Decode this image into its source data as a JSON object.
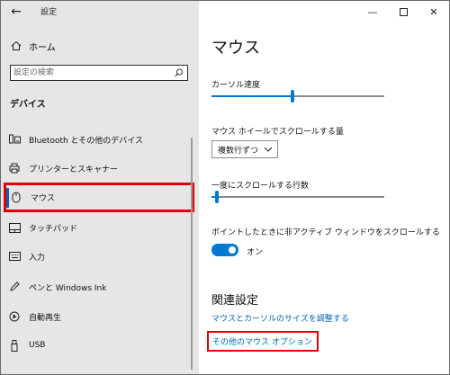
{
  "window": {
    "title": "設定"
  },
  "sidebar": {
    "home_label": "ホーム",
    "search_placeholder": "設定の検索",
    "section_title": "デバイス",
    "items": [
      {
        "label": "Bluetooth とその他のデバイス",
        "icon": "bluetooth-devices-icon"
      },
      {
        "label": "プリンターとスキャナー",
        "icon": "printer-icon"
      },
      {
        "label": "マウス",
        "icon": "mouse-icon",
        "selected": true
      },
      {
        "label": "タッチパッド",
        "icon": "touchpad-icon"
      },
      {
        "label": "入力",
        "icon": "keyboard-icon"
      },
      {
        "label": "ペンと Windows Ink",
        "icon": "pen-icon"
      },
      {
        "label": "自動再生",
        "icon": "autoplay-icon"
      },
      {
        "label": "USB",
        "icon": "usb-icon"
      }
    ]
  },
  "main": {
    "title": "マウス",
    "cursor_speed": {
      "label": "カーソル速度",
      "value": 0.47
    },
    "wheel_scroll": {
      "label": "マウス ホイールでスクロールする量",
      "selected": "複数行ずつ"
    },
    "lines_per_scroll": {
      "label": "一度にスクロールする行数",
      "value": 0.02
    },
    "inactive_scroll": {
      "label": "ポイントしたときに非アクティブ ウィンドウをスクロールする",
      "state": "オン",
      "on": true
    },
    "related": {
      "title": "関連設定",
      "links": [
        "マウスとカーソルのサイズを調整する",
        "その他のマウス オプション"
      ]
    }
  },
  "colors": {
    "accent": "#0078d4",
    "highlight": "#e0000a",
    "link": "#0066b4"
  }
}
